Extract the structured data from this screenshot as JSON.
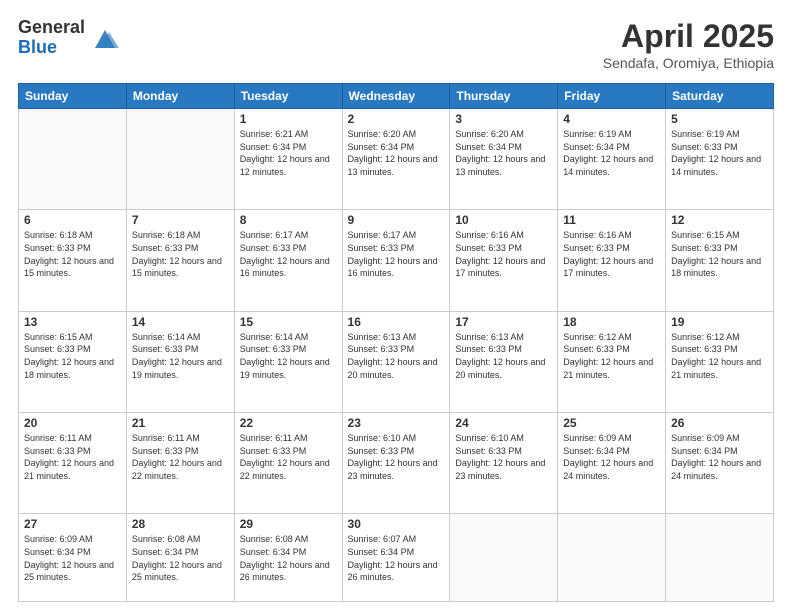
{
  "header": {
    "logo_general": "General",
    "logo_blue": "Blue",
    "month_title": "April 2025",
    "subtitle": "Sendafa, Oromiya, Ethiopia"
  },
  "weekdays": [
    "Sunday",
    "Monday",
    "Tuesday",
    "Wednesday",
    "Thursday",
    "Friday",
    "Saturday"
  ],
  "weeks": [
    [
      {
        "day": "",
        "info": ""
      },
      {
        "day": "",
        "info": ""
      },
      {
        "day": "1",
        "info": "Sunrise: 6:21 AM\nSunset: 6:34 PM\nDaylight: 12 hours and 12 minutes."
      },
      {
        "day": "2",
        "info": "Sunrise: 6:20 AM\nSunset: 6:34 PM\nDaylight: 12 hours and 13 minutes."
      },
      {
        "day": "3",
        "info": "Sunrise: 6:20 AM\nSunset: 6:34 PM\nDaylight: 12 hours and 13 minutes."
      },
      {
        "day": "4",
        "info": "Sunrise: 6:19 AM\nSunset: 6:34 PM\nDaylight: 12 hours and 14 minutes."
      },
      {
        "day": "5",
        "info": "Sunrise: 6:19 AM\nSunset: 6:33 PM\nDaylight: 12 hours and 14 minutes."
      }
    ],
    [
      {
        "day": "6",
        "info": "Sunrise: 6:18 AM\nSunset: 6:33 PM\nDaylight: 12 hours and 15 minutes."
      },
      {
        "day": "7",
        "info": "Sunrise: 6:18 AM\nSunset: 6:33 PM\nDaylight: 12 hours and 15 minutes."
      },
      {
        "day": "8",
        "info": "Sunrise: 6:17 AM\nSunset: 6:33 PM\nDaylight: 12 hours and 16 minutes."
      },
      {
        "day": "9",
        "info": "Sunrise: 6:17 AM\nSunset: 6:33 PM\nDaylight: 12 hours and 16 minutes."
      },
      {
        "day": "10",
        "info": "Sunrise: 6:16 AM\nSunset: 6:33 PM\nDaylight: 12 hours and 17 minutes."
      },
      {
        "day": "11",
        "info": "Sunrise: 6:16 AM\nSunset: 6:33 PM\nDaylight: 12 hours and 17 minutes."
      },
      {
        "day": "12",
        "info": "Sunrise: 6:15 AM\nSunset: 6:33 PM\nDaylight: 12 hours and 18 minutes."
      }
    ],
    [
      {
        "day": "13",
        "info": "Sunrise: 6:15 AM\nSunset: 6:33 PM\nDaylight: 12 hours and 18 minutes."
      },
      {
        "day": "14",
        "info": "Sunrise: 6:14 AM\nSunset: 6:33 PM\nDaylight: 12 hours and 19 minutes."
      },
      {
        "day": "15",
        "info": "Sunrise: 6:14 AM\nSunset: 6:33 PM\nDaylight: 12 hours and 19 minutes."
      },
      {
        "day": "16",
        "info": "Sunrise: 6:13 AM\nSunset: 6:33 PM\nDaylight: 12 hours and 20 minutes."
      },
      {
        "day": "17",
        "info": "Sunrise: 6:13 AM\nSunset: 6:33 PM\nDaylight: 12 hours and 20 minutes."
      },
      {
        "day": "18",
        "info": "Sunrise: 6:12 AM\nSunset: 6:33 PM\nDaylight: 12 hours and 21 minutes."
      },
      {
        "day": "19",
        "info": "Sunrise: 6:12 AM\nSunset: 6:33 PM\nDaylight: 12 hours and 21 minutes."
      }
    ],
    [
      {
        "day": "20",
        "info": "Sunrise: 6:11 AM\nSunset: 6:33 PM\nDaylight: 12 hours and 21 minutes."
      },
      {
        "day": "21",
        "info": "Sunrise: 6:11 AM\nSunset: 6:33 PM\nDaylight: 12 hours and 22 minutes."
      },
      {
        "day": "22",
        "info": "Sunrise: 6:11 AM\nSunset: 6:33 PM\nDaylight: 12 hours and 22 minutes."
      },
      {
        "day": "23",
        "info": "Sunrise: 6:10 AM\nSunset: 6:33 PM\nDaylight: 12 hours and 23 minutes."
      },
      {
        "day": "24",
        "info": "Sunrise: 6:10 AM\nSunset: 6:33 PM\nDaylight: 12 hours and 23 minutes."
      },
      {
        "day": "25",
        "info": "Sunrise: 6:09 AM\nSunset: 6:34 PM\nDaylight: 12 hours and 24 minutes."
      },
      {
        "day": "26",
        "info": "Sunrise: 6:09 AM\nSunset: 6:34 PM\nDaylight: 12 hours and 24 minutes."
      }
    ],
    [
      {
        "day": "27",
        "info": "Sunrise: 6:09 AM\nSunset: 6:34 PM\nDaylight: 12 hours and 25 minutes."
      },
      {
        "day": "28",
        "info": "Sunrise: 6:08 AM\nSunset: 6:34 PM\nDaylight: 12 hours and 25 minutes."
      },
      {
        "day": "29",
        "info": "Sunrise: 6:08 AM\nSunset: 6:34 PM\nDaylight: 12 hours and 26 minutes."
      },
      {
        "day": "30",
        "info": "Sunrise: 6:07 AM\nSunset: 6:34 PM\nDaylight: 12 hours and 26 minutes."
      },
      {
        "day": "",
        "info": ""
      },
      {
        "day": "",
        "info": ""
      },
      {
        "day": "",
        "info": ""
      }
    ]
  ]
}
